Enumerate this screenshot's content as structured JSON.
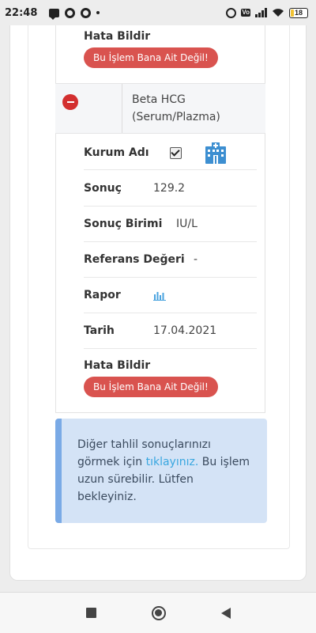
{
  "status_bar": {
    "time": "22:48",
    "battery": "18"
  },
  "top_section": {
    "error_label": "Hata Bildir",
    "error_button": "Bu İşlem Bana Ait Değil!"
  },
  "test": {
    "name": "Beta HCG (Serum/Plazma)",
    "rows": {
      "institution_label": "Kurum Adı",
      "result_label": "Sonuç",
      "result_value": "129.2",
      "unit_label": "Sonuç Birimi",
      "unit_value": "IU/L",
      "reference_label": "Referans Değeri",
      "reference_value": "-",
      "report_label": "Rapor",
      "date_label": "Tarih",
      "date_value": "17.04.2021"
    },
    "error_label": "Hata Bildir",
    "error_button": "Bu İşlem Bana Ait Değil!"
  },
  "info": {
    "text_before": "Diğer tahlil sonuçlarınızı görmek için ",
    "link": "tıklayınız.",
    "text_after": " Bu işlem uzun sürebilir. Lütfen bekleyiniz."
  },
  "colors": {
    "danger": "#d9534f",
    "info_bg": "#d4e3f6",
    "info_accent": "#7aaae6",
    "link": "#39a7e0",
    "icon_blue": "#3d8fd1"
  },
  "icons": [
    "message-icon",
    "chrome-icon",
    "alarm-icon",
    "volte-icon",
    "signal-icon",
    "wifi-icon",
    "battery-icon",
    "hospital-icon",
    "bar-chart-icon",
    "minus-circle-icon",
    "recent-apps-icon",
    "home-icon",
    "back-icon"
  ]
}
